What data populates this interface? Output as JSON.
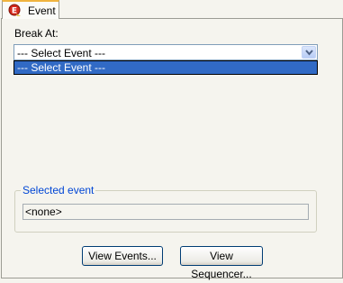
{
  "tab": {
    "label": "Event"
  },
  "form": {
    "break_at_label": "Break At:",
    "select_value": "--- Select Event ---",
    "options": [
      "--- Select Event ---"
    ]
  },
  "selected_event": {
    "legend": "Selected event",
    "value": "<none>"
  },
  "buttons": {
    "view_events": "View Events...",
    "view_sequencer": "View Sequencer..."
  },
  "colors": {
    "legend": "#0046d5",
    "selection": "#316ac5",
    "tab_accent": "#f0b440"
  }
}
